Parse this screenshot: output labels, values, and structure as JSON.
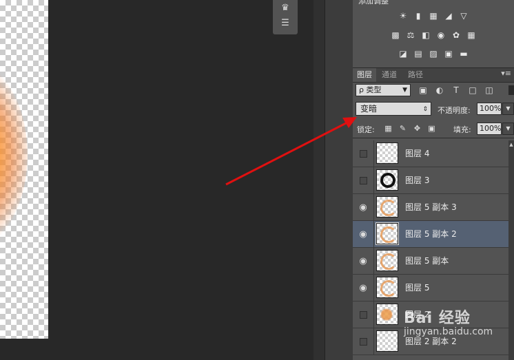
{
  "adjustments": {
    "title": "添加调整",
    "row1_icons": [
      "brightness-contrast-icon",
      "levels-icon",
      "curves-icon",
      "exposure-icon",
      "vibrance-icon"
    ],
    "row2_icons": [
      "hue-saturation-icon",
      "color-balance-icon",
      "black-white-icon",
      "photo-filter-icon",
      "channel-mixer-icon",
      "color-lookup-icon"
    ],
    "row3_icons": [
      "invert-icon",
      "posterize-icon",
      "threshold-icon",
      "selective-color-icon",
      "gradient-map-icon"
    ]
  },
  "tabs": [
    {
      "label": "图层",
      "active": true
    },
    {
      "label": "通道",
      "active": false
    },
    {
      "label": "路径",
      "active": false
    }
  ],
  "filter": {
    "kind_label": "ρ 类型",
    "icons": [
      "image-filter-icon",
      "adjustment-filter-icon",
      "type-filter-icon",
      "shape-filter-icon",
      "smart-object-filter-icon"
    ]
  },
  "blend": {
    "mode": "变暗",
    "opacity_label": "不透明度:",
    "opacity_value": "100%"
  },
  "lock": {
    "label": "锁定:",
    "fill_label": "填充:",
    "fill_value": "100%"
  },
  "layers": [
    {
      "name": "图层 4",
      "visible": false,
      "thumb": "empty",
      "selected": false
    },
    {
      "name": "图层 3",
      "visible": false,
      "thumb": "ring",
      "selected": false
    },
    {
      "name": "图层 5 副本 3",
      "visible": true,
      "thumb": "swirl",
      "selected": false
    },
    {
      "name": "图层 5 副本 2",
      "visible": true,
      "thumb": "swirl",
      "selected": true
    },
    {
      "name": "图层 5 副本",
      "visible": true,
      "thumb": "swirl",
      "selected": false
    },
    {
      "name": "图层 5",
      "visible": true,
      "thumb": "swirl",
      "selected": false
    },
    {
      "name": "图层 2",
      "visible": false,
      "thumb": "blob",
      "selected": false
    },
    {
      "name": "图层 2 副本 2",
      "visible": false,
      "thumb": "empty",
      "selected": false
    }
  ],
  "watermark": {
    "brand": "Bai 经验",
    "url": "jingyan.baidu.com"
  },
  "colors": {
    "annotation_arrow": "#e01010",
    "selected_layer": "#556173"
  }
}
